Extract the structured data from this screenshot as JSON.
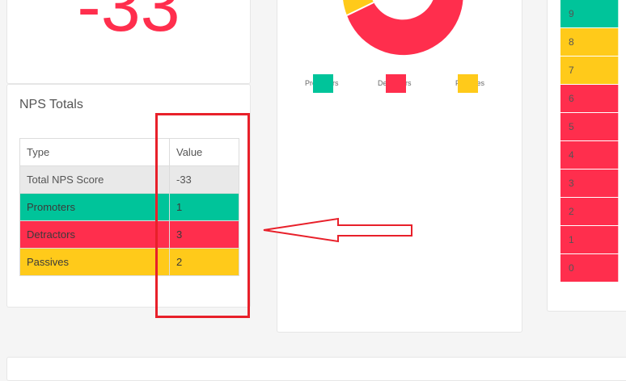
{
  "score_card": {
    "value": "-33"
  },
  "totals": {
    "title": "NPS Totals",
    "columns": [
      "Type",
      "Value"
    ],
    "rows": [
      {
        "type": "Total NPS Score",
        "value": "-33",
        "color": "#e9e9e9"
      },
      {
        "type": "Promoters",
        "value": "1",
        "color": "#00c49a"
      },
      {
        "type": "Detractors",
        "value": "3",
        "color": "#ff2e4d"
      },
      {
        "type": "Passives",
        "value": "2",
        "color": "#ffca1a"
      }
    ]
  },
  "donut": {
    "segments": [
      {
        "name": "Promoters",
        "color": "#00c49a"
      },
      {
        "name": "Detractors",
        "color": "#ff2e4d"
      },
      {
        "name": "Passives",
        "color": "#ffca1a"
      }
    ],
    "legend": [
      {
        "label": "Promoters",
        "color": "#00c49a"
      },
      {
        "label": "Detractors",
        "color": "#ff2e4d"
      },
      {
        "label": "Passives",
        "color": "#ffca1a"
      }
    ]
  },
  "score_scale": {
    "rows": [
      {
        "label": "9",
        "color": "#00c49a"
      },
      {
        "label": "8",
        "color": "#ffca1a"
      },
      {
        "label": "7",
        "color": "#ffca1a"
      },
      {
        "label": "6",
        "color": "#ff2e4d"
      },
      {
        "label": "5",
        "color": "#ff2e4d"
      },
      {
        "label": "4",
        "color": "#ff2e4d"
      },
      {
        "label": "3",
        "color": "#ff2e4d"
      },
      {
        "label": "2",
        "color": "#ff2e4d"
      },
      {
        "label": "1",
        "color": "#ff2e4d"
      },
      {
        "label": "0",
        "color": "#ff2e4d"
      }
    ]
  },
  "annotation": {
    "color": "#e8202a"
  }
}
